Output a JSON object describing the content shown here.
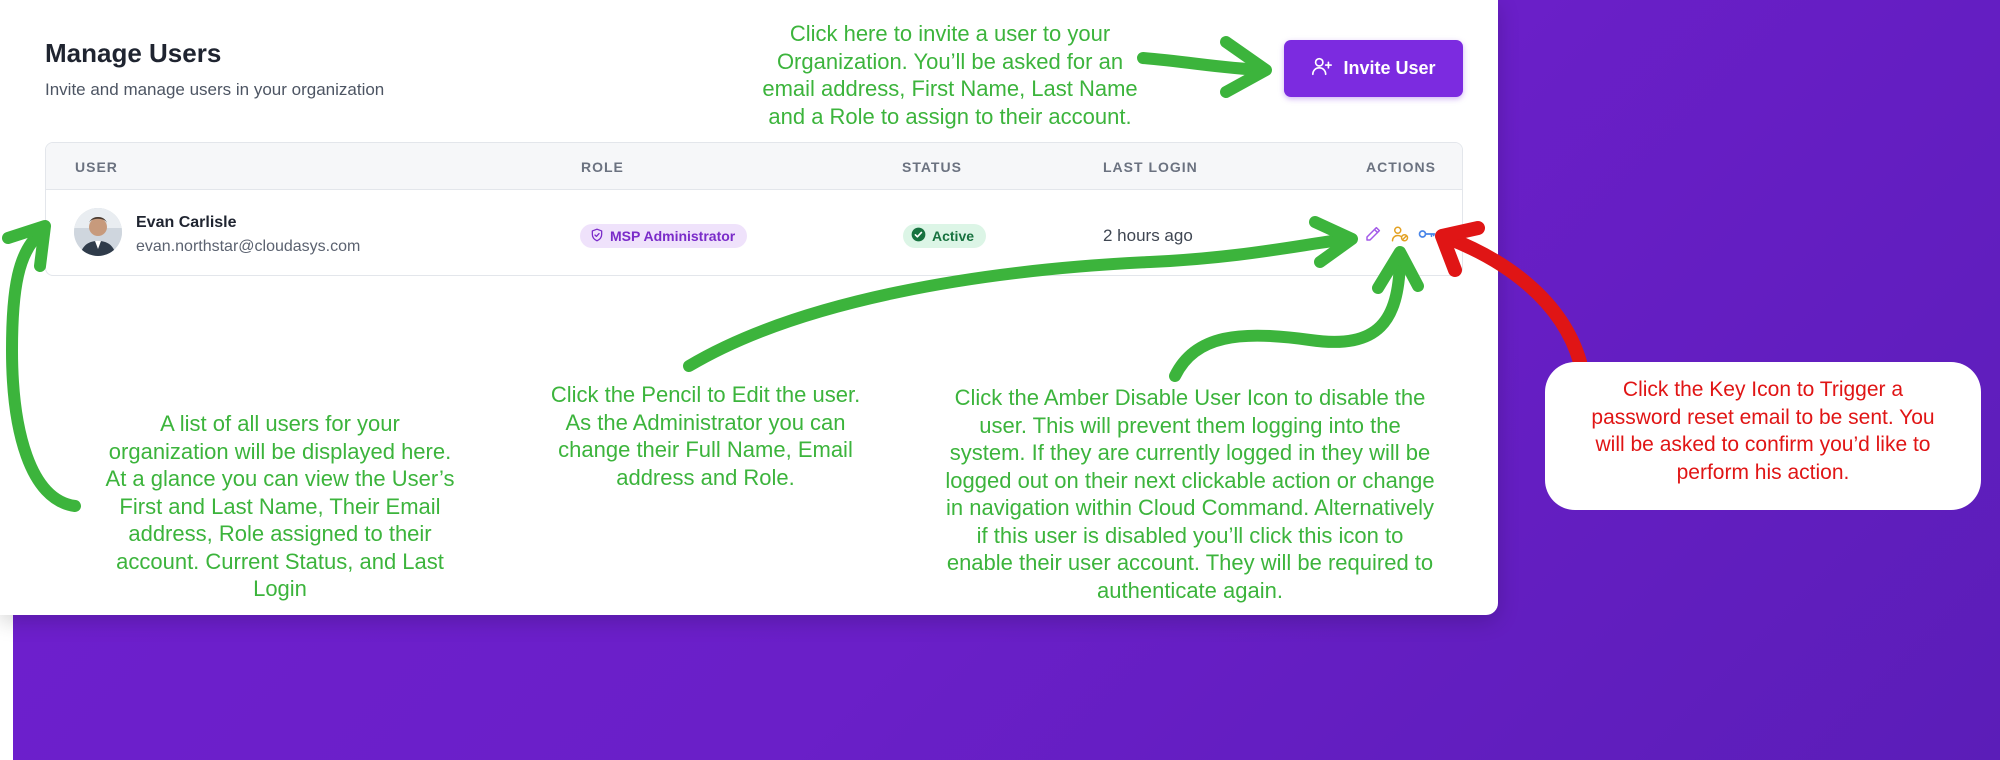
{
  "header": {
    "title": "Manage Users",
    "subtitle": "Invite and manage users in your organization",
    "invite_button_label": "Invite User"
  },
  "table": {
    "columns": [
      "USER",
      "ROLE",
      "STATUS",
      "LAST LOGIN",
      "ACTIONS"
    ],
    "rows": [
      {
        "name": "Evan Carlisle",
        "email": "evan.northstar@cloudasys.com",
        "role": "MSP Administrator",
        "status": "Active",
        "last_login": "2 hours ago"
      }
    ]
  },
  "annotations": {
    "invite": [
      "Click here to invite a user to your",
      "Organization. You’ll be asked for an",
      "email address, First Name, Last Name",
      "and a Role to assign to their account."
    ],
    "list": [
      "A list of all users for your",
      "organization will be displayed here.",
      "At a glance you can view the User’s",
      "First and Last Name, Their Email",
      "address, Role assigned to their",
      "account. Current Status, and Last",
      "Login"
    ],
    "pencil": [
      "Click the Pencil to Edit the user.",
      "As the Administrator you can",
      "change their Full Name, Email",
      "address and Role."
    ],
    "disable": [
      "Click the Amber Disable User Icon to disable the",
      "user. This will prevent them logging into the",
      "system. If they are currently logged in they will be",
      "logged out on their next clickable action or change",
      "in navigation within Cloud Command. Alternatively",
      "if this user is disabled you’ll click this icon to",
      "enable their user account. They will be required to",
      "authenticate again."
    ],
    "key": [
      "Click the Key Icon to Trigger a",
      "password reset email to be sent. You",
      "will be asked to confirm you’d like to",
      "perform his action."
    ]
  },
  "colors": {
    "background_purple": "#6a1fc8",
    "accent_purple": "#7c2be0",
    "annotation_green": "#3cb43c",
    "annotation_red": "#e01515",
    "status_green": "#17723f",
    "edit_icon": "#a35ae8",
    "disable_icon": "#e3a122",
    "key_icon": "#4a86e8"
  },
  "icons": {
    "invite": "user-plus-icon",
    "role": "shield-icon",
    "status": "check-circle-icon",
    "edit": "pencil-icon",
    "disable": "user-disable-icon",
    "reset": "key-icon"
  }
}
